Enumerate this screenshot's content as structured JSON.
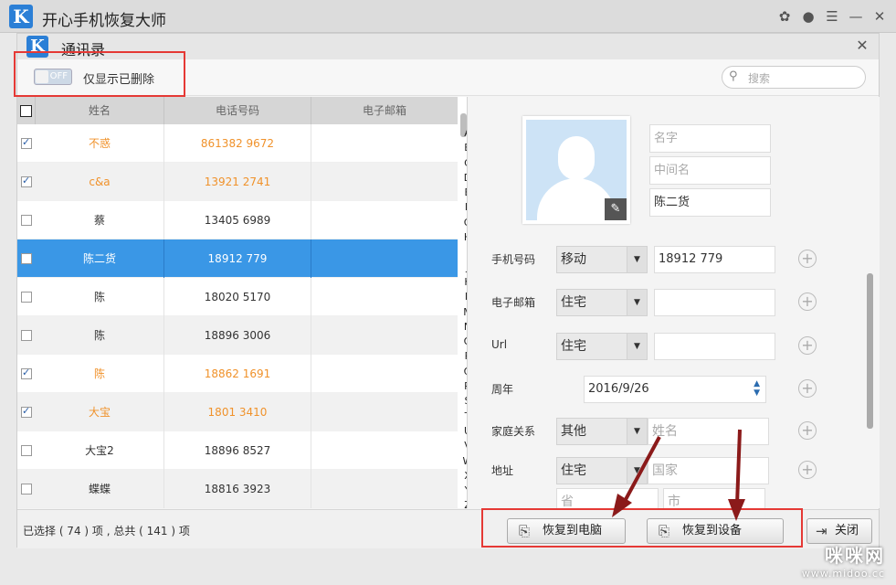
{
  "app": {
    "logo": "K",
    "title": "开心手机恢复大师"
  },
  "dialog": {
    "logo": "K",
    "title": "通讯录"
  },
  "toolbar": {
    "toggle_state": "OFF",
    "toggle_label": "仅显示已删除",
    "search_placeholder": "搜索"
  },
  "list": {
    "columns": [
      "姓名",
      "电话号码",
      "电子邮箱"
    ],
    "rows": [
      {
        "checked": true,
        "name": "不惑",
        "phone": "861382 9672",
        "style": "orange"
      },
      {
        "checked": true,
        "name": "c&a",
        "phone": "13921 2741",
        "style": "orange"
      },
      {
        "checked": false,
        "name": "蔡",
        "phone": "13405 6989",
        "style": "normal"
      },
      {
        "checked": false,
        "name": "陈二货",
        "phone": "18912 779",
        "style": "selected"
      },
      {
        "checked": false,
        "name": "陈",
        "phone": "18020 5170",
        "style": "normal"
      },
      {
        "checked": false,
        "name": "陈",
        "phone": "18896 3006",
        "style": "normal"
      },
      {
        "checked": true,
        "name": "陈",
        "phone": "18862 1691",
        "style": "orange"
      },
      {
        "checked": true,
        "name": "大宝",
        "phone": "1801 3410",
        "style": "orange"
      },
      {
        "checked": false,
        "name": "大宝2",
        "phone": "18896 8527",
        "style": "normal"
      },
      {
        "checked": false,
        "name": "蝶蝶",
        "phone": "18816 3923",
        "style": "normal"
      }
    ],
    "alphabet": [
      "A",
      "B",
      "C",
      "D",
      "E",
      "F",
      "G",
      "H",
      "I",
      "J",
      "K",
      "L",
      "M",
      "N",
      "O",
      "P",
      "Q",
      "R",
      "S",
      "T",
      "U",
      "V",
      "W",
      "X",
      "Y",
      "Z"
    ]
  },
  "detail": {
    "first_name_ph": "名字",
    "middle_name_ph": "中间名",
    "last_name": "陈二货",
    "fields": {
      "mobile": {
        "label": "手机号码",
        "type": "移动",
        "value": "18912 779"
      },
      "email": {
        "label": "电子邮箱",
        "type": "住宅",
        "value": ""
      },
      "url": {
        "label": "Url",
        "type": "住宅",
        "value": ""
      },
      "anniv": {
        "label": "周年",
        "value": "2016/9/26"
      },
      "family": {
        "label": "家庭关系",
        "type": "其他",
        "placeholder": "姓名"
      },
      "address": {
        "label": "地址",
        "type": "住宅",
        "country_ph": "国家",
        "province_ph": "省",
        "city_ph": "市"
      }
    }
  },
  "bottom": {
    "status": "已选择 ( 74 ) 项 , 总共 ( 141 ) 项",
    "restore_pc": "恢复到电脑",
    "restore_device": "恢复到设备",
    "close": "关闭"
  },
  "watermark": {
    "line1": "咪咪网",
    "line2": "www.midoo.cc"
  },
  "colors": {
    "selected_row": "#3a97e6",
    "orange_text": "#f0922b",
    "highlight": "#e53935",
    "arrow": "#8b1a1a"
  }
}
